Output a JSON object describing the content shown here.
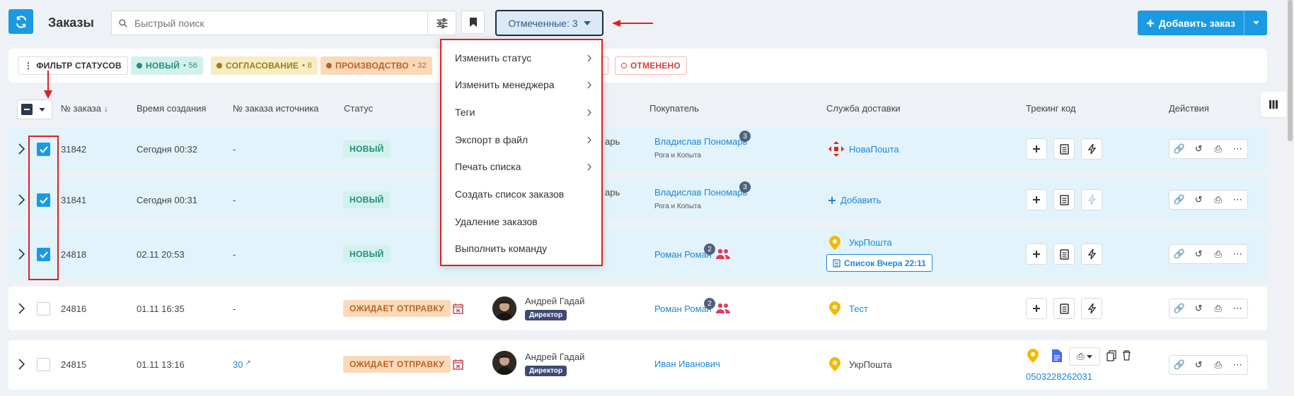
{
  "header": {
    "title": "Заказы",
    "search_placeholder": "Быстрый поиск",
    "selected_label": "Отмеченные: 3",
    "add_order_label": "Добавить заказ"
  },
  "status_filter": {
    "filter_label": "ФИЛЬТР СТАТУСОВ",
    "chips": [
      {
        "label": "НОВЫЙ",
        "count": "56"
      },
      {
        "label": "СОГЛАСОВАНИЕ",
        "count": "8"
      },
      {
        "label": "ПРОИЗВОДСТВО",
        "count": "32"
      },
      {
        "label": "ОТМЕНЕНО",
        "count": ""
      }
    ]
  },
  "columns": {
    "order_no": "№ заказа",
    "created": "Время создания",
    "source_no": "№ заказа источника",
    "status": "Статус",
    "buyer": "Покупатель",
    "delivery": "Служба доставки",
    "tracking": "Трекинг код",
    "actions": "Действия"
  },
  "dropdown": {
    "items": [
      {
        "label": "Изменить статус",
        "submenu": true
      },
      {
        "label": "Изменить менеджера",
        "submenu": true
      },
      {
        "label": "Теги",
        "submenu": true
      },
      {
        "label": "Экспорт в файл",
        "submenu": true
      },
      {
        "label": "Печать списка",
        "submenu": true
      },
      {
        "label": "Создать список заказов",
        "submenu": false
      },
      {
        "label": "Удаление заказов",
        "submenu": false
      },
      {
        "label": "Выполнить команду",
        "submenu": false
      }
    ]
  },
  "rows": [
    {
      "id": "31842",
      "created": "Сегодня 00:32",
      "source": "-",
      "status": "НОВЫЙ",
      "manager_fragment": "арь",
      "buyer": "Владислав Пономарь",
      "buyer_count": "3",
      "buyer_sub": "Рога и Копыта",
      "delivery": "НоваПошта",
      "checked": true
    },
    {
      "id": "31841",
      "created": "Сегодня 00:31",
      "source": "-",
      "status": "НОВЫЙ",
      "manager_fragment": "арь",
      "buyer": "Владислав Пономарь",
      "buyer_count": "3",
      "buyer_sub": "Рога и Копыта",
      "delivery": "Добавить",
      "checked": true
    },
    {
      "id": "24818",
      "created": "02.11 20:53",
      "source": "-",
      "status": "НОВЫЙ",
      "buyer": "Роман Роман",
      "buyer_count": "2",
      "delivery": "УкрПошта",
      "list_chip": "Список Вчера 22:11",
      "checked": true
    },
    {
      "id": "24816",
      "created": "01.11 16:35",
      "source": "-",
      "status": "ОЖИДАЕТ ОТПРАВКУ",
      "manager": "Андрей Гадай",
      "role": "Директор",
      "buyer": "Роман Роман",
      "buyer_count": "2",
      "delivery": "Тест",
      "checked": false
    },
    {
      "id": "24815",
      "created": "01.11 13:16",
      "source": "30",
      "status": "ОЖИДАЕТ ОТПРАВКУ",
      "manager": "Андрей Гадай",
      "role": "Директор",
      "buyer": "Иван Иванович",
      "delivery": "УкрПошта",
      "tracking": "0503228262031",
      "checked": false
    }
  ],
  "colors": {
    "accent": "#1b9ae3",
    "annotation": "#e02020",
    "status_new_bg": "#d3f1ec",
    "status_wait_bg": "#fbd9b8"
  }
}
